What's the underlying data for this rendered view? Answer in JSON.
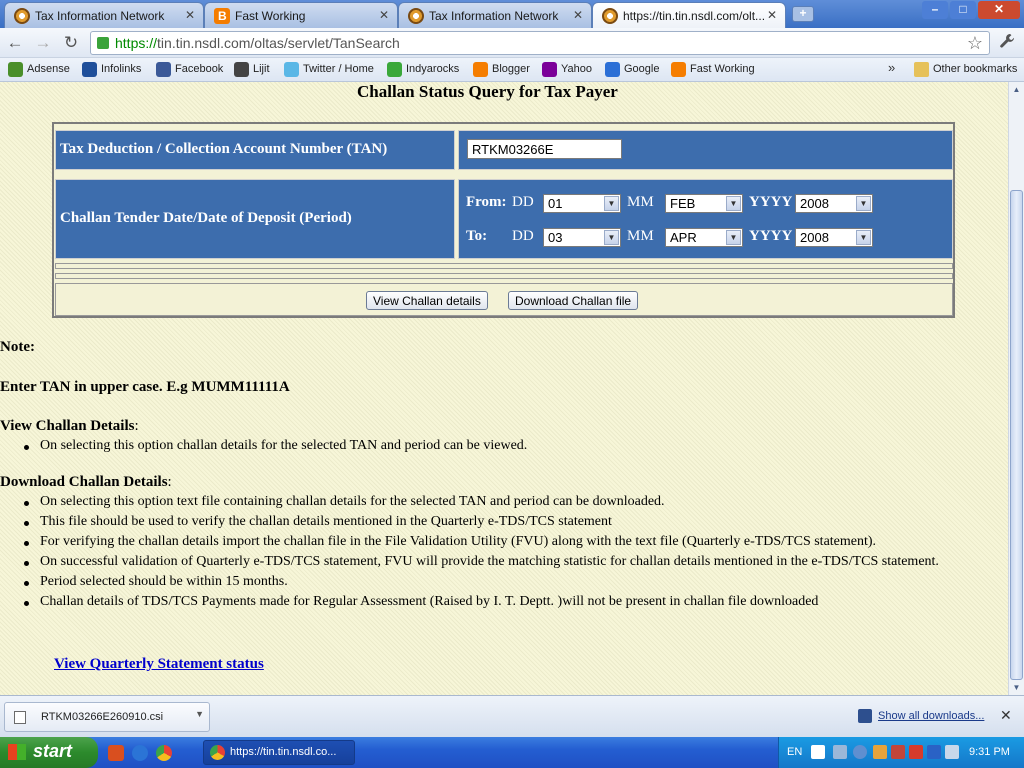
{
  "browser": {
    "tabs": [
      {
        "title": "Tax Information Network",
        "favicon": "tin-icon",
        "active": false
      },
      {
        "title": "Fast Working",
        "favicon": "blogger-icon",
        "active": false
      },
      {
        "title": "Tax Information Network",
        "favicon": "tin-icon",
        "active": false
      },
      {
        "title": "https://tin.tin.nsdl.com/olt...",
        "favicon": "tin-icon",
        "active": true
      }
    ],
    "new_tab_label": "+",
    "window_min": "–",
    "window_max": "□",
    "window_close": "✕",
    "back": "←",
    "forward": "→",
    "reload": "↻",
    "url_scheme": "https://",
    "url_rest": "tin.tin.nsdl.com/oltas/servlet/TanSearch",
    "star": "☆",
    "wrench": "🔧"
  },
  "bookmarks": {
    "items": [
      {
        "label": "Adsense",
        "color": "#4a8f2a"
      },
      {
        "label": "Infolinks",
        "color": "#1f4f9a"
      },
      {
        "label": "Facebook",
        "color": "#3b5998"
      },
      {
        "label": "Lijit",
        "color": "#444444"
      },
      {
        "label": "Twitter / Home",
        "color": "#5ab7e6"
      },
      {
        "label": "Indyarocks",
        "color": "#3aa83a"
      },
      {
        "label": "Blogger",
        "color": "#f57d00"
      },
      {
        "label": "Yahoo",
        "color": "#7b0099"
      },
      {
        "label": "Google",
        "color": "#2b6fd6"
      },
      {
        "label": "Fast Working",
        "color": "#f57d00"
      }
    ],
    "overflow_chevron": "»",
    "other_bookmarks": "Other bookmarks"
  },
  "page": {
    "heading": "Challan Status Query for Tax Payer",
    "tan_label": "Tax Deduction / Collection Account Number (TAN)",
    "tan_value": "RTKM03266E",
    "period_label": "Challan Tender Date/Date of Deposit (Period)",
    "from_label": "From:",
    "to_label": "To:",
    "dd_label": "DD",
    "mm_label": "MM",
    "yyyy_label": "YYYY",
    "from": {
      "dd": "01",
      "mm": "FEB",
      "yyyy": "2008"
    },
    "to": {
      "dd": "03",
      "mm": "APR",
      "yyyy": "2008"
    },
    "view_button": "View Challan details",
    "download_button": "Download Challan file",
    "note_label": "Note:",
    "tan_hint": "Enter TAN in upper case. E.g MUMM11111A",
    "view_heading": "View Challan Details",
    "view_bullets": [
      "On selecting this option challan details for the selected TAN and period can be viewed."
    ],
    "download_heading": "Download Challan Details",
    "download_bullets": [
      "On selecting this option text file containing challan details for the selected TAN and period can be downloaded.",
      "This file should be used to verify the challan details mentioned in the Quarterly e-TDS/TCS statement",
      "For verifying the challan details import the challan file in the File Validation Utility (FVU) along with the text file (Quarterly e-TDS/TCS statement).",
      "On successful validation of Quarterly e-TDS/TCS statement, FVU will provide the matching statistic for challan details mentioned in the e-TDS/TCS statement.",
      "Period selected should be within 15 months.",
      "Challan details of TDS/TCS Payments made for Regular Assessment (Raised by I. T. Deptt. )will not be present in challan file downloaded"
    ],
    "qs_link": "View Quarterly Statement status"
  },
  "downloads": {
    "file_name": "RTKM03266E260910.csi",
    "show_all": "Show all downloads...",
    "close": "✕"
  },
  "taskbar": {
    "start_label": "start",
    "task_label": "https://tin.tin.nsdl.co...",
    "lang": "EN",
    "clock": "9:31 PM"
  }
}
